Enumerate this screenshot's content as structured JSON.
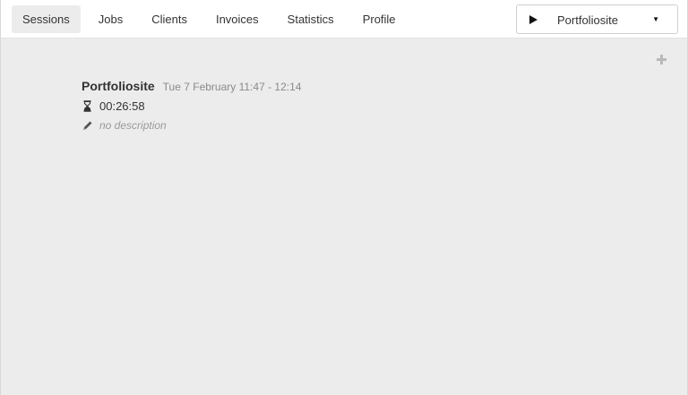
{
  "nav": {
    "items": [
      {
        "label": "Sessions",
        "active": true
      },
      {
        "label": "Jobs",
        "active": false
      },
      {
        "label": "Clients",
        "active": false
      },
      {
        "label": "Invoices",
        "active": false
      },
      {
        "label": "Statistics",
        "active": false
      },
      {
        "label": "Profile",
        "active": false
      }
    ]
  },
  "timer": {
    "selected_job": "Portfoliosite",
    "play_icon": "play-icon",
    "dropdown_icon": "caret-down-icon"
  },
  "session": {
    "job": "Portfoliosite",
    "time_range": "Tue 7 February 11:47 - 12:14",
    "duration": "00:26:58",
    "description": "no description"
  },
  "colors": {
    "background": "#ececec",
    "topbar": "#ffffff",
    "active_tab": "#ececec",
    "muted_text": "#8a8a8a"
  }
}
